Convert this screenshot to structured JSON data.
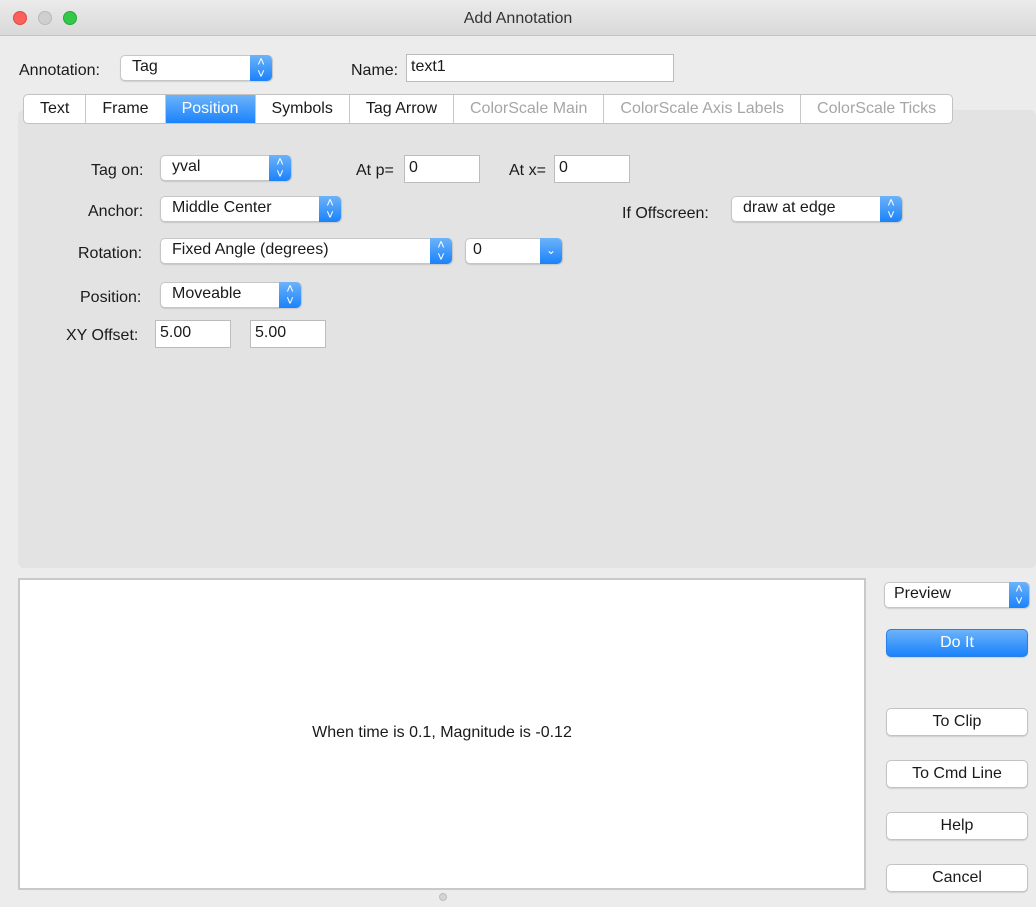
{
  "window": {
    "title": "Add Annotation"
  },
  "header": {
    "annotation_label": "Annotation:",
    "annotation_value": "Tag",
    "name_label": "Name:",
    "name_value": "text1"
  },
  "tabs": [
    {
      "label": "Text",
      "state": "normal"
    },
    {
      "label": "Frame",
      "state": "normal"
    },
    {
      "label": "Position",
      "state": "selected"
    },
    {
      "label": "Symbols",
      "state": "normal"
    },
    {
      "label": "Tag Arrow",
      "state": "normal"
    },
    {
      "label": "ColorScale Main",
      "state": "disabled"
    },
    {
      "label": "ColorScale Axis Labels",
      "state": "disabled"
    },
    {
      "label": "ColorScale Ticks",
      "state": "disabled"
    }
  ],
  "position_tab": {
    "tag_on_label": "Tag on:",
    "tag_on_value": "yval",
    "at_p_label": "At p=",
    "at_p_value": "0",
    "at_x_label": "At x=",
    "at_x_value": "0",
    "anchor_label": "Anchor:",
    "anchor_value": "Middle Center",
    "offscreen_label": "If Offscreen:",
    "offscreen_value": "draw at edge",
    "rotation_label": "Rotation:",
    "rotation_mode": "Fixed Angle (degrees)",
    "rotation_angle": "0",
    "position_label": "Position:",
    "position_value": "Moveable",
    "xy_offset_label": "XY Offset:",
    "x_offset": "5.00",
    "y_offset": "5.00"
  },
  "preview": {
    "text": "When time is 0.1, Magnitude is -0.12"
  },
  "actions": {
    "mode_value": "Preview",
    "do_it": "Do It",
    "to_clip": "To Clip",
    "to_cmd_line": "To Cmd Line",
    "help": "Help",
    "cancel": "Cancel"
  },
  "colors": {
    "accent": "#1a82fb",
    "panel": "#e3e3e3",
    "disabled_text": "#a6a6a6"
  }
}
